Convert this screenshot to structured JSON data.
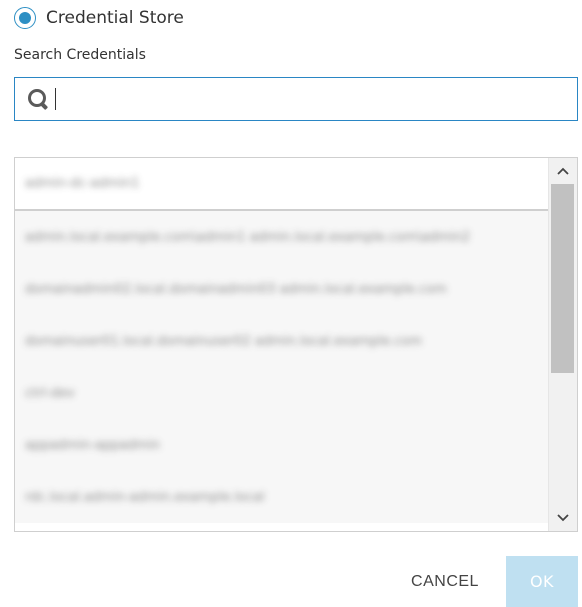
{
  "source": {
    "option_label": "Credential Store",
    "selected": true
  },
  "search": {
    "label": "Search Credentials",
    "value": "",
    "placeholder": ""
  },
  "credentials": {
    "items": [
      "admin-dc-admin1",
      "admin.local.example.com\\admin1 admin.local.example.com\\admin2",
      "domainadmin02.local.domainadmin03 admin.local.example.com",
      "domainuser01.local.domainuser02 admin.local.example.com",
      "ctrl-dev",
      "appadmin-appadmin",
      "rdc.local.admin-admin.example.local"
    ]
  },
  "actions": {
    "cancel_label": "CANCEL",
    "ok_label": "OK"
  },
  "colors": {
    "accent": "#2d8fc4",
    "ok_disabled_bg": "#bfe0f1"
  },
  "icons": {
    "search": "search-icon",
    "scroll_up": "chevron-up-icon",
    "scroll_down": "chevron-down-icon"
  }
}
